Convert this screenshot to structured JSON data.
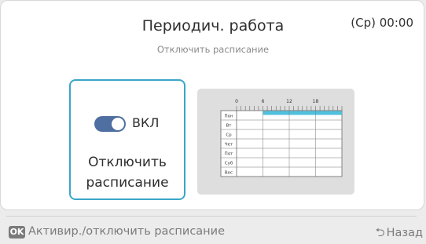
{
  "header": {
    "title": "Периодич. работа",
    "clock": "(Ср) 00:00",
    "subtitle": "Отключить расписание"
  },
  "toggle": {
    "state_label": "ВКЛ",
    "card_label_line1": "Отключить",
    "card_label_line2": "расписание",
    "on": true
  },
  "schedule_preview": {
    "hour_ticks": [
      "0",
      "6",
      "12",
      "18"
    ],
    "days": [
      "Пон",
      "Вт",
      "Ср",
      "Чет",
      "Пят",
      "Суб",
      "Вос"
    ],
    "active_day": "Пон",
    "active_from_hour": 6,
    "active_to_hour": 24
  },
  "footer": {
    "ok_label": "OK",
    "hint": "Активир./отключить расписание",
    "back_label": "Назад",
    "back_icon": "return-arrow-icon"
  },
  "colors": {
    "accent": "#3aa6c8",
    "switch_on": "#4f6fa2",
    "schedule_highlight": "#4fc0de"
  }
}
